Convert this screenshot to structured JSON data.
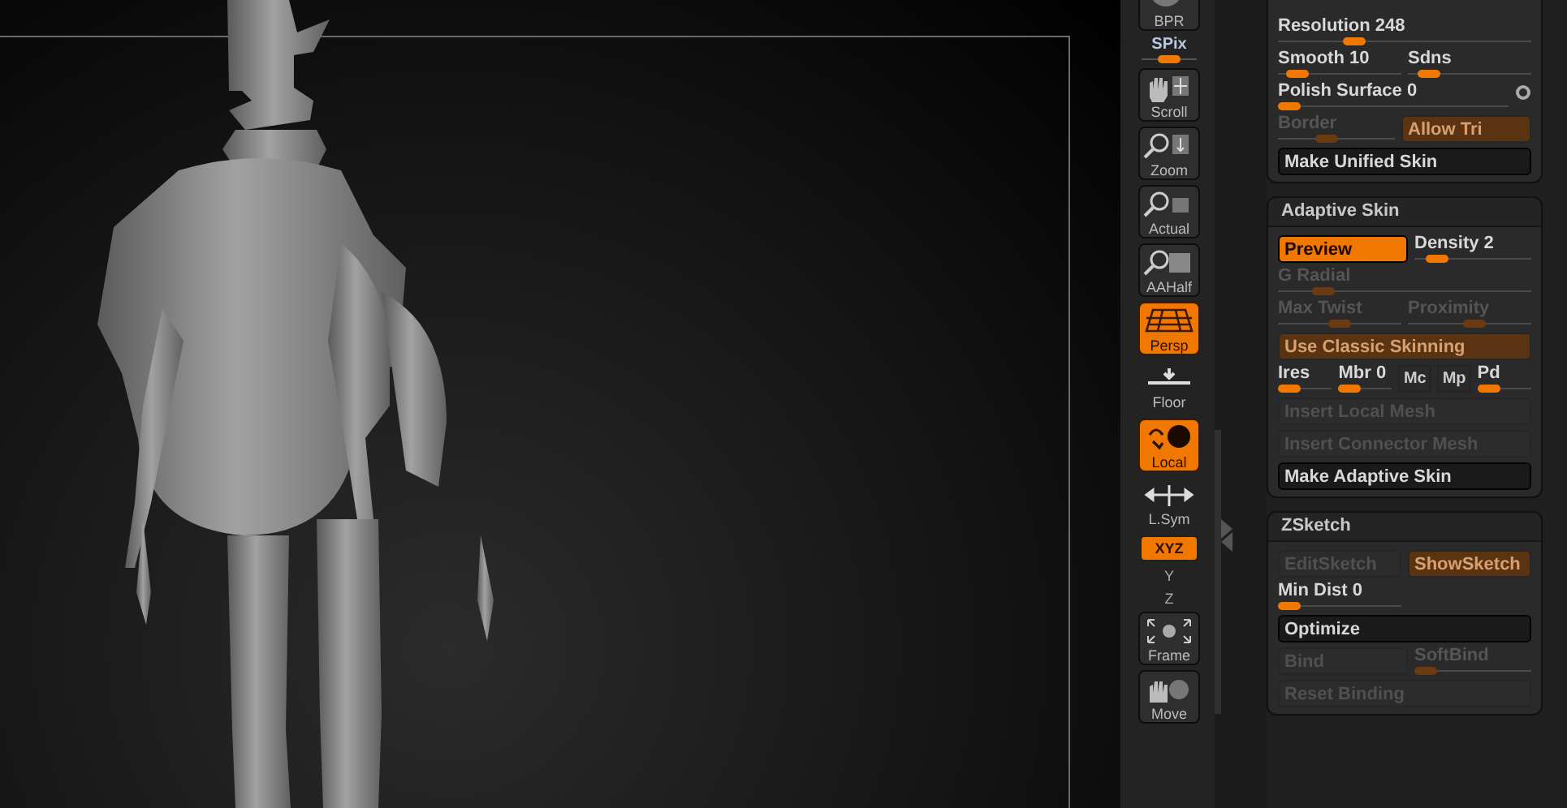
{
  "shelf": [
    {
      "kind": "button",
      "label": "BPR",
      "selected": false
    },
    {
      "kind": "slider",
      "label": "SPix",
      "level": 0.5
    },
    {
      "kind": "button",
      "label": "Scroll",
      "selected": false
    },
    {
      "kind": "button",
      "label": "Zoom",
      "selected": false
    },
    {
      "kind": "button",
      "label": "Actual",
      "selected": false
    },
    {
      "kind": "button",
      "label": "AAHalf",
      "selected": false
    },
    {
      "kind": "button",
      "label": "Persp",
      "selected": true
    },
    {
      "kind": "flat",
      "label": "Floor"
    },
    {
      "kind": "button",
      "label": "Local",
      "selected": true
    },
    {
      "kind": "flat",
      "label": "L.Sym"
    },
    {
      "kind": "toggle",
      "label": "XYZ",
      "selected": true
    },
    {
      "kind": "axis",
      "label": "Y"
    },
    {
      "kind": "axis",
      "label": "Z"
    },
    {
      "kind": "button",
      "label": "Frame",
      "selected": false
    },
    {
      "kind": "button",
      "label": "Move",
      "selected": false
    }
  ],
  "panel": {
    "sections": [
      {
        "rows": [
          [
            {
              "kind": "slider",
              "label": "Resolution 248",
              "level": 0.28,
              "disabled": false
            }
          ],
          [
            {
              "kind": "slider",
              "label": "Smooth 10",
              "level": 0.08,
              "disabled": false
            },
            {
              "kind": "slider",
              "label": "Sdns",
              "level": 0.1,
              "disabled": false
            }
          ],
          [
            {
              "kind": "slider",
              "label": "Polish Surface 0",
              "level": 0,
              "disabled": false
            },
            {
              "kind": "dot"
            }
          ],
          [
            {
              "kind": "slider",
              "label": "Border",
              "level": 0.4,
              "disabled": true
            },
            {
              "kind": "button",
              "label": "Allow Tri",
              "selected": true,
              "disabled": true
            }
          ],
          [
            {
              "kind": "wide",
              "label": "Make Unified Skin",
              "selected": false,
              "disabled": false
            }
          ]
        ]
      },
      {
        "title": "Adaptive Skin",
        "rows": [
          [
            {
              "kind": "button",
              "label": "Preview",
              "selected": true,
              "disabled": false
            },
            {
              "kind": "slider",
              "label": "Density 2",
              "level": 0.12,
              "disabled": false
            }
          ],
          [
            {
              "kind": "slider",
              "label": "G Radial",
              "level": 0.15,
              "disabled": true
            }
          ],
          [
            {
              "kind": "slider",
              "label": "Max Twist",
              "level": 0.5,
              "disabled": true
            },
            {
              "kind": "slider",
              "label": "Proximity",
              "level": 0.55,
              "disabled": true
            }
          ],
          [
            {
              "kind": "wide",
              "label": "Use Classic Skinning",
              "selected": true,
              "disabled": true
            }
          ],
          [
            {
              "kind": "slider",
              "label": "Ires",
              "level": 0,
              "disabled": false
            },
            {
              "kind": "slider",
              "label": "Mbr 0",
              "level": 0,
              "disabled": false
            },
            {
              "kind": "mini",
              "label": "Mc"
            },
            {
              "kind": "mini",
              "label": "Mp"
            },
            {
              "kind": "slider",
              "label": "Pd",
              "level": 0,
              "disabled": false
            }
          ],
          [
            {
              "kind": "wide",
              "label": "Insert Local Mesh",
              "selected": false,
              "disabled": true
            }
          ],
          [
            {
              "kind": "wide",
              "label": "Insert Connector Mesh",
              "selected": false,
              "disabled": true
            }
          ],
          [
            {
              "kind": "wide",
              "label": "Make Adaptive Skin",
              "selected": false,
              "disabled": false
            }
          ]
        ]
      },
      {
        "title": "ZSketch",
        "rows": [
          [
            {
              "kind": "button",
              "label": "EditSketch",
              "selected": false,
              "disabled": true
            },
            {
              "kind": "button",
              "label": "ShowSketch",
              "selected": true,
              "disabled": true
            }
          ],
          [
            {
              "kind": "slider",
              "label": "Min Dist 0",
              "level": 0,
              "disabled": false
            },
            {
              "kind": "blank"
            }
          ],
          [
            {
              "kind": "wide",
              "label": "Optimize",
              "selected": false,
              "disabled": false
            }
          ],
          [
            {
              "kind": "button",
              "label": "Bind",
              "selected": false,
              "disabled": true
            },
            {
              "kind": "slider",
              "label": "SoftBind",
              "level": 0,
              "disabled": true
            }
          ],
          [
            {
              "kind": "wide",
              "label": "Reset Binding",
              "selected": false,
              "disabled": true
            }
          ]
        ]
      }
    ]
  }
}
